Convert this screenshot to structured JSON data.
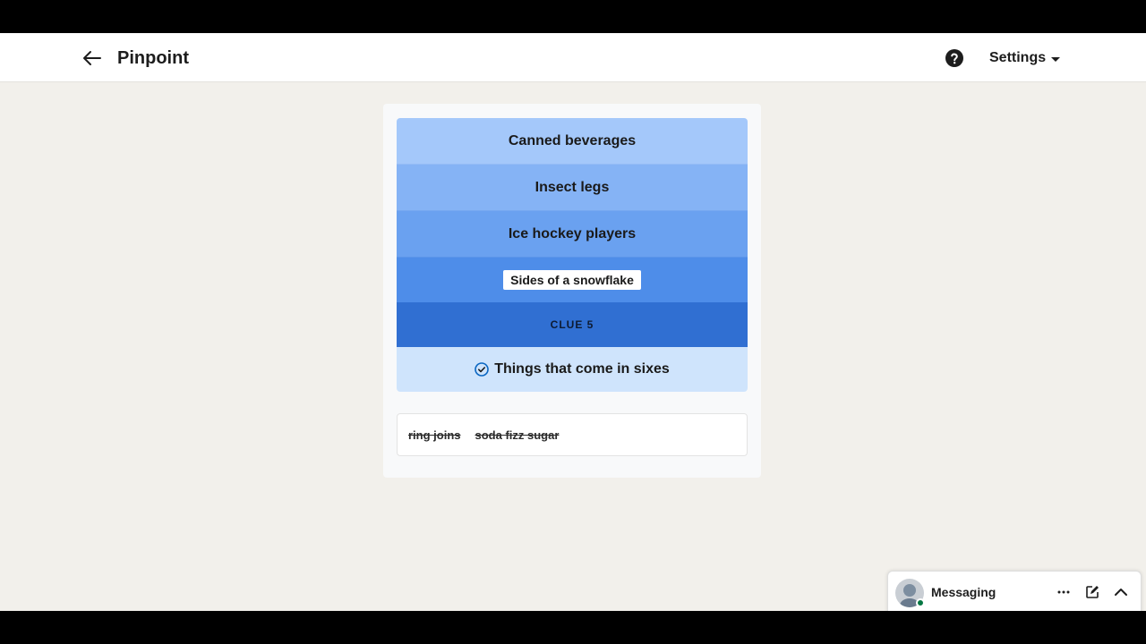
{
  "header": {
    "back_icon": "arrow-left-icon",
    "title": "Pinpoint",
    "help_icon": "question-circle-icon",
    "settings_label": "Settings",
    "settings_icon": "caret-down-icon"
  },
  "game": {
    "clues": [
      "Canned beverages",
      "Insect legs",
      "Ice hockey players",
      "Sides of a snowflake",
      "CLUE 5"
    ],
    "answer": "Things that come in sixes",
    "answer_icon": "check-circle-icon",
    "guesses": [
      "ring joins",
      "soda fizz sugar"
    ]
  },
  "messaging": {
    "label": "Messaging",
    "icons": [
      "more-horizontal-icon",
      "compose-icon",
      "chevron-up-icon"
    ]
  },
  "colors": {
    "page_bg": "#f2f0eb",
    "clue_1": "#a4c8fa",
    "clue_2": "#85b3f5",
    "clue_3": "#6aa1f0",
    "clue_4": "#4e8de9",
    "clue_5": "#306fd2",
    "answer_bg": "#cfe4fc",
    "online_status": "#057642"
  }
}
